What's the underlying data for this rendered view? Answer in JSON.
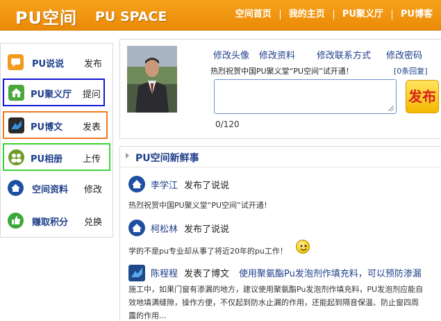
{
  "header": {
    "logo_cn": "PU空间",
    "logo_en": "PU SPACE",
    "nav": [
      "空间首页",
      "我的主页",
      "PU聚义厅",
      "PU博客"
    ]
  },
  "sidebar": {
    "items": [
      {
        "name": "PU说说",
        "action": "发布",
        "icon": "speech-bubble-icon",
        "color": "#f29a1e"
      },
      {
        "name": "PU聚义厅",
        "action": "提问",
        "icon": "house-icon",
        "color": "#4aa83a"
      },
      {
        "name": "PU博文",
        "action": "发表",
        "icon": "blog-arrow-icon",
        "color": "#2a6fd0"
      },
      {
        "name": "PU相册",
        "action": "上传",
        "icon": "people-icon",
        "color": "#6e9a2a"
      },
      {
        "name": "空间资料",
        "action": "修改",
        "icon": "home-circle-icon",
        "color": "#1f4fa0"
      },
      {
        "name": "赚取积分",
        "action": "兑换",
        "icon": "thumbs-up-icon",
        "color": "#3aa83a"
      }
    ]
  },
  "profile": {
    "links": [
      "修改头像",
      "修改资料",
      "修改联系方式",
      "修改密码"
    ],
    "notice": "热烈祝贺中国PU聚义堂“PU空间”试开通！",
    "replies": "[0条回复]",
    "counter": "0/120",
    "publish_label": "发布"
  },
  "feed": {
    "title": "PU空间新鲜事",
    "entries": [
      {
        "user": "李学江",
        "action": "发布了说说",
        "text": "热烈祝贺中国PU聚义堂“PU空间”试开通！"
      },
      {
        "user": "柯松林",
        "action": "发布了说说",
        "text": "学的不是pu专业却从事了将近20年的pu工作！"
      },
      {
        "user": "陈程程",
        "action": "发表了博文",
        "link": "使用聚氨酯Pu发泡剂作填充料，可以预防渗漏",
        "lines": [
          "施工中，如果门窗有渗漏的地方，建议使用聚氨酯Pu发泡剂作填充料，PU发泡剂应能自",
          "效地填满缝隙，操作方便，不仅起到防水止漏的作用，还能起到隔音保温、防止窗四周",
          "露的作用..."
        ]
      }
    ]
  }
}
